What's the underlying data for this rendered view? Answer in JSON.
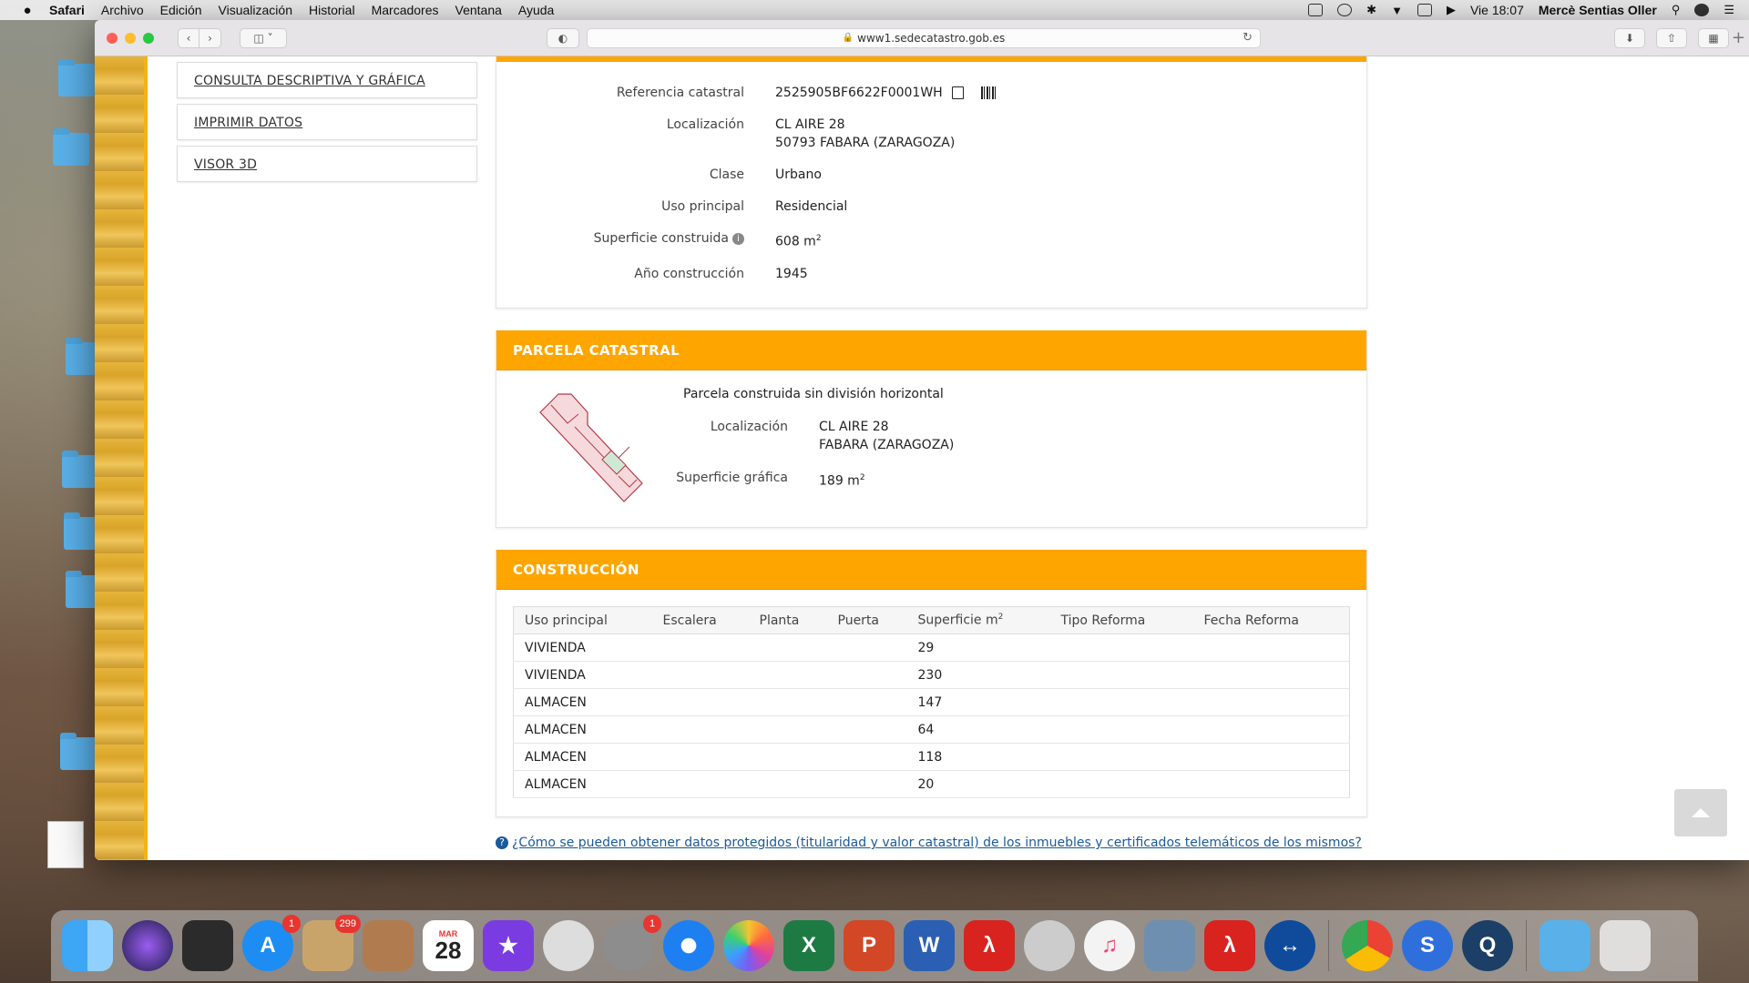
{
  "menubar": {
    "app": "Safari",
    "items": [
      "Archivo",
      "Edición",
      "Visualización",
      "Historial",
      "Marcadores",
      "Ventana",
      "Ayuda"
    ],
    "clock": "Vie 18:07",
    "user": "Mercè Sentias Oller"
  },
  "browser": {
    "url": "www1.sedecatastro.gob.es"
  },
  "side_menu": {
    "items": [
      "CONSULTA DESCRIPTIVA Y GRÁFICA",
      "IMPRIMIR DATOS",
      "VISOR 3D"
    ]
  },
  "inmueble": {
    "referencia_label": "Referencia catastral",
    "referencia_value": "2525905BF6622F0001WH",
    "localizacion_label": "Localización",
    "localizacion_line1": "CL AIRE 28",
    "localizacion_line2": "50793 FABARA (ZARAGOZA)",
    "clase_label": "Clase",
    "clase_value": "Urbano",
    "uso_label": "Uso principal",
    "uso_value": "Residencial",
    "superficie_label": "Superficie construida",
    "superficie_value": "608 m",
    "superficie_unit_exp": "2",
    "anio_label": "Año construcción",
    "anio_value": "1945"
  },
  "parcela": {
    "header": "PARCELA CATASTRAL",
    "title": "Parcela construida sin división horizontal",
    "localizacion_label": "Localización",
    "localizacion_line1": "CL AIRE 28",
    "localizacion_line2": "FABARA (ZARAGOZA)",
    "superficie_label": "Superficie gráfica",
    "superficie_value": "189 m",
    "superficie_unit_exp": "2"
  },
  "construccion": {
    "header": "CONSTRUCCIÓN",
    "columns": [
      "Uso principal",
      "Escalera",
      "Planta",
      "Puerta",
      "Superficie m",
      "Tipo Reforma",
      "Fecha Reforma"
    ],
    "superficie_exp": "2",
    "rows": [
      [
        "VIVIENDA",
        "",
        "",
        "",
        "29",
        "",
        ""
      ],
      [
        "VIVIENDA",
        "",
        "",
        "",
        "230",
        "",
        ""
      ],
      [
        "ALMACEN",
        "",
        "",
        "",
        "147",
        "",
        ""
      ],
      [
        "ALMACEN",
        "",
        "",
        "",
        "64",
        "",
        ""
      ],
      [
        "ALMACEN",
        "",
        "",
        "",
        "118",
        "",
        ""
      ],
      [
        "ALMACEN",
        "",
        "",
        "",
        "20",
        "",
        ""
      ]
    ]
  },
  "footer": {
    "question": "¿Cómo se pueden obtener datos protegidos (titularidad y valor catastral) de los inmuebles y certificados telemáticos de los mismos?"
  },
  "dock": {
    "badges": {
      "appstore": "1",
      "mail": "299",
      "settings": "1"
    },
    "calendar_month": "MAR",
    "calendar_day": "28"
  },
  "colors": {
    "accent": "#ffa500",
    "link": "#1a5a9a"
  }
}
